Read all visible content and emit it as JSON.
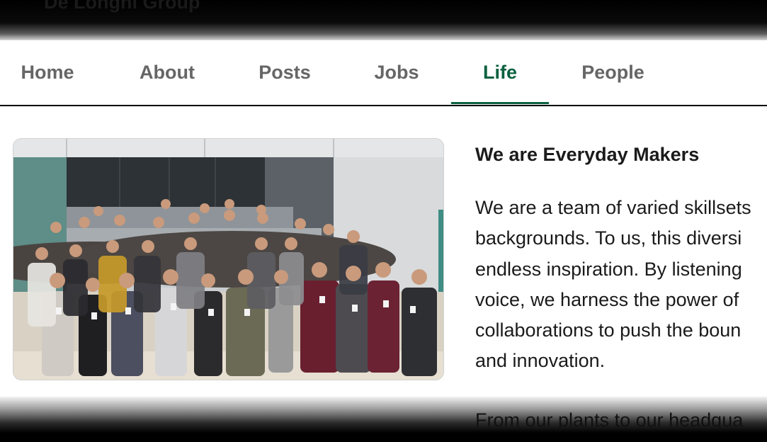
{
  "company": {
    "name": "De Longhi Group"
  },
  "tabs": [
    {
      "label": "Home",
      "active": false
    },
    {
      "label": "About",
      "active": false
    },
    {
      "label": "Posts",
      "active": false
    },
    {
      "label": "Jobs",
      "active": false
    },
    {
      "label": "Life",
      "active": true
    },
    {
      "label": "People",
      "active": false
    }
  ],
  "colors": {
    "accent": "#0b6140",
    "tab_text": "#666666",
    "body_text": "#1b1b1b"
  },
  "section": {
    "heading": "We are Everyday Makers",
    "paragraph_lines": [
      "We are a team of varied skillsets",
      "backgrounds. To us, this diversi",
      "endless inspiration. By listening",
      "voice, we harness the power of",
      "collaborations to push the boun",
      "and innovation."
    ],
    "next_paragraph_start": "From our plants to our headqua"
  },
  "image": {
    "icon": "group-photo"
  }
}
